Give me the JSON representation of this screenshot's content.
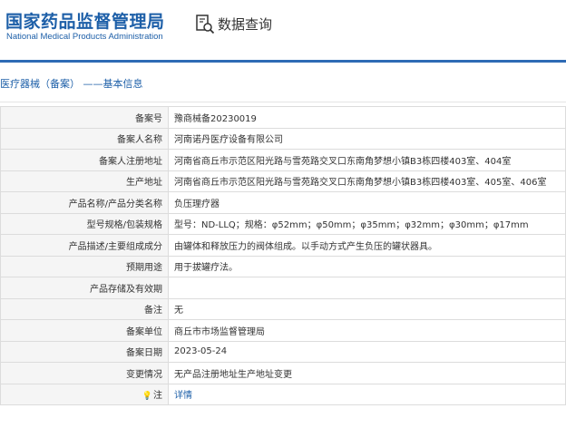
{
  "header": {
    "logo_cn": "国家药品监督管理局",
    "logo_en": "National Medical Products Administration",
    "query_title": "数据查询"
  },
  "breadcrumb": "医疗器械（备案） ——基本信息",
  "rows": [
    {
      "label": "备案号",
      "value": "豫商械备20230019"
    },
    {
      "label": "备案人名称",
      "value": "河南诺丹医疗设备有限公司"
    },
    {
      "label": "备案人注册地址",
      "value": "河南省商丘市示范区阳光路与雪苑路交叉口东南角梦想小镇B3栋四楼403室、404室"
    },
    {
      "label": "生产地址",
      "value": "河南省商丘市示范区阳光路与雪苑路交叉口东南角梦想小镇B3栋四楼403室、405室、406室"
    },
    {
      "label": "产品名称/产品分类名称",
      "value": "负压理疗器"
    },
    {
      "label": "型号规格/包装规格",
      "value": "型号：ND-LLQ；规格：φ52mm；φ50mm；φ35mm；φ32mm；φ30mm；φ17mm"
    },
    {
      "label": "产品描述/主要组成成分",
      "value": "由罐体和释放压力的阀体组成。以手动方式产生负压的罐状器具。"
    },
    {
      "label": "预期用途",
      "value": "用于拔罐疗法。"
    },
    {
      "label": "产品存储及有效期",
      "value": ""
    },
    {
      "label": "备注",
      "value": "无"
    },
    {
      "label": "备案单位",
      "value": "商丘市市场监督管理局"
    },
    {
      "label": "备案日期",
      "value": "2023-05-24"
    },
    {
      "label": "变更情况",
      "value": "无产品注册地址生产地址变更"
    }
  ],
  "note_row": {
    "icon": "lightbulb-icon",
    "label": "注",
    "link_text": "详情"
  },
  "colors": {
    "brand": "#1d5fa8",
    "label_bg": "#f5f5f5",
    "border": "#dcdcdc"
  }
}
